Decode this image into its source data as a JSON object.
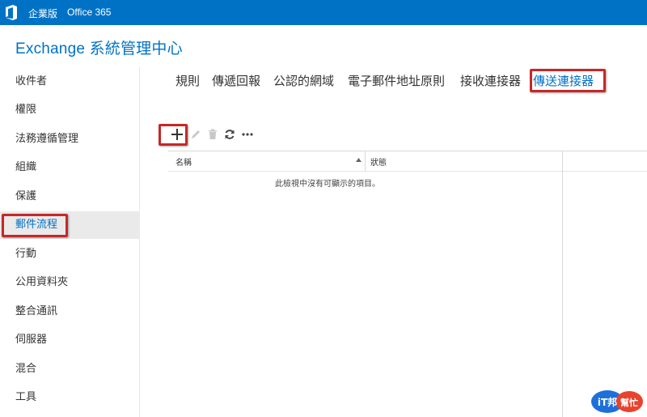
{
  "topbar": {
    "edition_label": "企業版",
    "office365_label": "Office 365",
    "logo_icon": "office-logo-icon",
    "bg_color": "#0072c6"
  },
  "app": {
    "title": "Exchange 系統管理中心"
  },
  "sidebar": {
    "items": [
      {
        "label": "收件者"
      },
      {
        "label": "權限"
      },
      {
        "label": "法務遵循管理"
      },
      {
        "label": "組織"
      },
      {
        "label": "保護"
      },
      {
        "label": "郵件流程",
        "active": true
      },
      {
        "label": "行動"
      },
      {
        "label": "公用資料夾"
      },
      {
        "label": "整合通訊"
      },
      {
        "label": "伺服器"
      },
      {
        "label": "混合"
      },
      {
        "label": "工具"
      }
    ]
  },
  "tabs": [
    {
      "label": "規則"
    },
    {
      "label": "傳遞回報"
    },
    {
      "label": "公認的網域"
    },
    {
      "label": "電子郵件地址原則"
    },
    {
      "label": "接收連接器"
    },
    {
      "label": "傳送連接器",
      "active": true
    }
  ],
  "toolbar": {
    "add_icon": "plus-icon",
    "edit_icon": "pencil-icon",
    "delete_icon": "trash-icon",
    "refresh_icon": "refresh-icon",
    "more_icon": "more-icon"
  },
  "table": {
    "columns": [
      "名稱",
      "狀態"
    ],
    "sort_icon": "sort-ascending-icon",
    "empty_message": "此檢視中沒有可顯示的項目。"
  },
  "watermark": {
    "line1": "iT邦",
    "line2": "幫忙"
  },
  "colors": {
    "accent": "#0072c6",
    "highlight": "#c62828"
  }
}
